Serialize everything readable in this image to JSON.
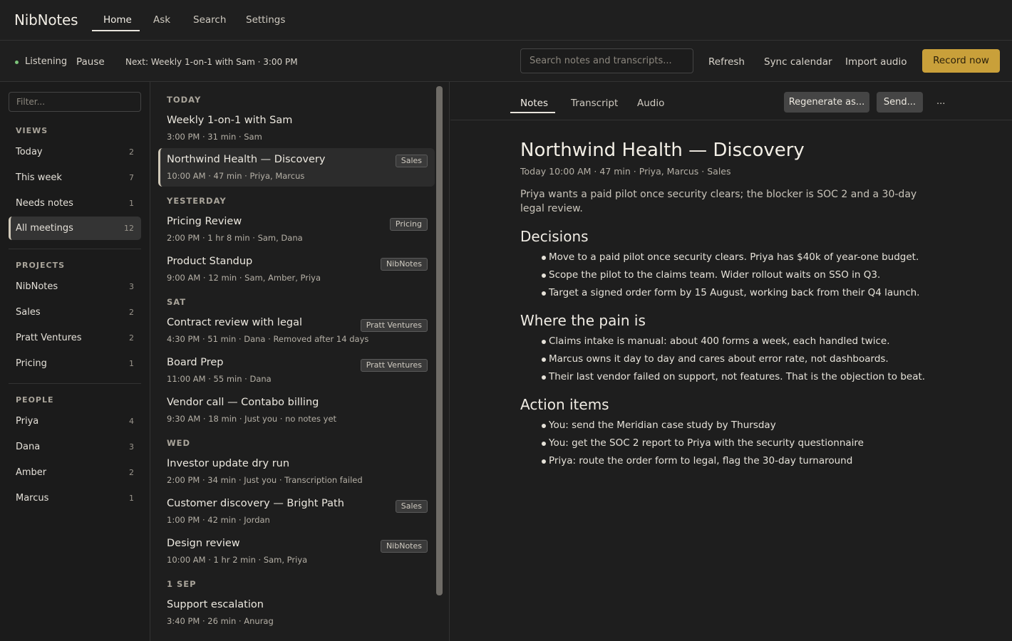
{
  "app": {
    "brand": "NibNotes"
  },
  "nav": {
    "tabs": [
      "Home",
      "Ask",
      "Search",
      "Settings"
    ]
  },
  "toolbar": {
    "status": "Listening",
    "pause": "Pause",
    "next": "Next: Weekly 1-on-1 with Sam · 3:00 PM",
    "search_placeholder": "Search notes and transcripts...",
    "refresh": "Refresh",
    "sync": "Sync calendar",
    "import": "Import audio",
    "record": "Record now",
    "colors": {
      "accent": "#c9a03a",
      "status_dot": "#7cc47a"
    }
  },
  "sidebar": {
    "filter_placeholder": "Filter...",
    "views_label": "VIEWS",
    "views": [
      {
        "label": "Today",
        "count": "2"
      },
      {
        "label": "This week",
        "count": "7"
      },
      {
        "label": "Needs notes",
        "count": "1"
      },
      {
        "label": "All meetings",
        "count": "12"
      }
    ],
    "projects_label": "PROJECTS",
    "projects": [
      {
        "label": "NibNotes",
        "count": "3"
      },
      {
        "label": "Sales",
        "count": "2"
      },
      {
        "label": "Pratt Ventures",
        "count": "2"
      },
      {
        "label": "Pricing",
        "count": "1"
      }
    ],
    "people_label": "PEOPLE",
    "people": [
      {
        "label": "Priya",
        "count": "4"
      },
      {
        "label": "Dana",
        "count": "3"
      },
      {
        "label": "Amber",
        "count": "2"
      },
      {
        "label": "Marcus",
        "count": "1"
      }
    ]
  },
  "meetings": {
    "groups": [
      "TODAY",
      "YESTERDAY",
      "SAT",
      "WED",
      "1 SEP"
    ],
    "items": [
      {
        "title": "Weekly 1-on-1 with Sam",
        "meta": "3:00 PM  ·  31 min  ·  Sam",
        "tag": ""
      },
      {
        "title": "Northwind Health — Discovery",
        "meta": "10:00 AM  ·  47 min  ·  Priya, Marcus",
        "tag": "Sales"
      },
      {
        "title": "Pricing Review",
        "meta": "2:00 PM  ·  1 hr 8 min  ·  Sam, Dana",
        "tag": "Pricing"
      },
      {
        "title": "Product Standup",
        "meta": "9:00 AM  ·  12 min  ·  Sam, Amber, Priya",
        "tag": "NibNotes"
      },
      {
        "title": "Contract review with legal",
        "meta": "4:30 PM  ·  51 min  ·  Dana  ·  Removed after 14 days",
        "tag": "Pratt Ventures"
      },
      {
        "title": "Board Prep",
        "meta": "11:00 AM  ·  55 min  ·  Dana",
        "tag": "Pratt Ventures"
      },
      {
        "title": "Vendor call — Contabo billing",
        "meta": "9:30 AM  ·  18 min  ·  Just you  ·  no notes yet",
        "tag": ""
      },
      {
        "title": "Investor update dry run",
        "meta": "2:00 PM  ·  34 min  ·  Just you  ·  Transcription failed",
        "tag": ""
      },
      {
        "title": "Customer discovery — Bright Path",
        "meta": "1:00 PM  ·  42 min  ·  Jordan",
        "tag": "Sales"
      },
      {
        "title": "Design review",
        "meta": "10:00 AM  ·  1 hr 2 min  ·  Sam, Priya",
        "tag": "NibNotes"
      },
      {
        "title": "Support escalation",
        "meta": "3:40 PM  ·  26 min  ·  Anurag",
        "tag": ""
      }
    ]
  },
  "detail": {
    "tabs": [
      "Notes",
      "Transcript",
      "Audio"
    ],
    "regenerate": "Regenerate as...",
    "send": "Send...",
    "more": "...",
    "title": "Northwind Health — Discovery",
    "meta": "Today 10:00 AM · 47 min · Priya, Marcus · Sales",
    "summary": "Priya wants a paid pilot once security clears; the blocker is SOC 2 and a 30-day legal review.",
    "sections": [
      {
        "heading": "Decisions",
        "bullets": [
          "Move to a paid pilot once security clears. Priya has $40k of year-one budget.",
          "Scope the pilot to the claims team. Wider rollout waits on SSO in Q3.",
          "Target a signed order form by 15 August, working back from their Q4 launch."
        ]
      },
      {
        "heading": "Where the pain is",
        "bullets": [
          "Claims intake is manual: about 400 forms a week, each handled twice.",
          "Marcus owns it day to day and cares about error rate, not dashboards.",
          "Their last vendor failed on support, not features. That is the objection to beat."
        ]
      },
      {
        "heading": "Action items",
        "bullets": [
          "You: send the Meridian case study by Thursday",
          "You: get the SOC 2 report to Priya with the security questionnaire",
          "Priya: route the order form to legal, flag the 30-day turnaround"
        ]
      }
    ]
  }
}
